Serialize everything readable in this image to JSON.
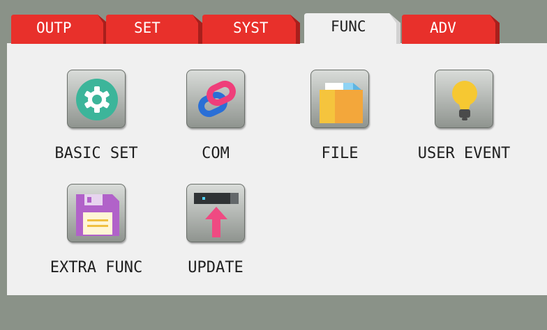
{
  "tabs": [
    {
      "label": "OUTP",
      "active": false
    },
    {
      "label": "SET",
      "active": false
    },
    {
      "label": "SYST",
      "active": false
    },
    {
      "label": "FUNC",
      "active": true
    },
    {
      "label": "ADV",
      "active": false
    }
  ],
  "items": [
    {
      "label": "BASIC SET",
      "icon": "gear-icon"
    },
    {
      "label": "COM",
      "icon": "link-icon"
    },
    {
      "label": "FILE",
      "icon": "folder-icon"
    },
    {
      "label": "USER EVENT",
      "icon": "lightbulb-icon"
    },
    {
      "label": "EXTRA FUNC",
      "icon": "floppy-disk-icon"
    },
    {
      "label": "UPDATE",
      "icon": "upload-icon"
    }
  ],
  "colors": {
    "tab_red": "#e8302b",
    "tab_red_edge": "#a81f1c",
    "active_tab": "#f0f0f0",
    "panel": "#f0f0f0",
    "frame": "#8a9288"
  }
}
